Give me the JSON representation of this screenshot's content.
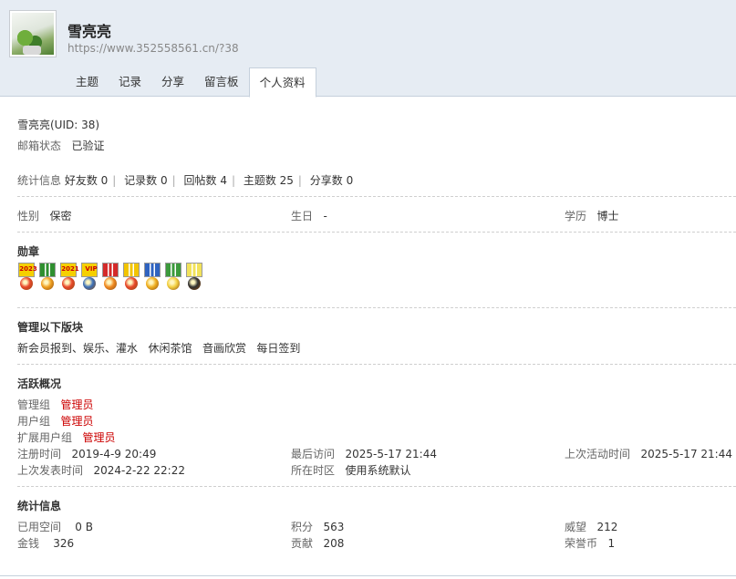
{
  "profile": {
    "name": "雪亮亮",
    "url": "https://www.352558561.cn/?38",
    "uid_line": "雪亮亮(UID: 38)",
    "email_label": "邮箱状态",
    "email_value": "已验证"
  },
  "tabs": [
    "主题",
    "记录",
    "分享",
    "留言板",
    "个人资料"
  ],
  "stats_line": {
    "label": "统计信息",
    "items": [
      "好友数 0",
      "记录数 0",
      "回帖数 4",
      "主题数 25",
      "分享数 0"
    ]
  },
  "basic": {
    "gender_label": "性别",
    "gender_value": "保密",
    "birthday_label": "生日",
    "birthday_value": "-",
    "education_label": "学历",
    "education_value": "博士"
  },
  "medals": {
    "title": "勋章",
    "items": [
      {
        "ribbon_text": "2023",
        "ribbon": "#f5d000",
        "coin": "#e8482a",
        "name": "medal-2023-icon"
      },
      {
        "ribbon_text": "",
        "ribbon": "#2f8f2f",
        "coin": "#f0a020",
        "name": "medal-green-red-icon"
      },
      {
        "ribbon_text": "2021",
        "ribbon": "#f5d000",
        "coin": "#e8482a",
        "name": "medal-2021-icon"
      },
      {
        "ribbon_text": "VIP",
        "ribbon": "#f5d000",
        "coin": "#3a6fb8",
        "name": "medal-vip-icon"
      },
      {
        "ribbon_text": "",
        "ribbon": "#d42a2a",
        "coin": "#f08a20",
        "name": "medal-red-white-icon"
      },
      {
        "ribbon_text": "",
        "ribbon": "#f2c400",
        "coin": "#e8482a",
        "name": "medal-yellow-red-icon"
      },
      {
        "ribbon_text": "",
        "ribbon": "#2f63c0",
        "coin": "#f0b020",
        "name": "medal-blue-icon"
      },
      {
        "ribbon_text": "",
        "ribbon": "#3c9a3c",
        "coin": "#f3d040",
        "name": "medal-star-icon"
      },
      {
        "ribbon_text": "",
        "ribbon": "#f2e25a",
        "coin": "#303030",
        "name": "medal-dark-coin-icon"
      }
    ]
  },
  "manage": {
    "title": "管理以下版块",
    "boards": [
      "新会员报到、娱乐、灌水",
      "休闲茶馆",
      "音画欣赏",
      "每日签到"
    ]
  },
  "activity": {
    "title": "活跃概况",
    "admin_group_label": "管理组",
    "admin_group_value": "管理员",
    "user_group_label": "用户组",
    "user_group_value": "管理员",
    "ext_group_label": "扩展用户组",
    "ext_group_value": "管理员",
    "register_label": "注册时间",
    "register_value": "2019-4-9 20:49",
    "last_visit_label": "最后访问",
    "last_visit_value": "2025-5-17 21:44",
    "last_active_label": "上次活动时间",
    "last_active_value": "2025-5-17 21:44",
    "last_post_label": "上次发表时间",
    "last_post_value": "2024-2-22 22:22",
    "timezone_label": "所在时区",
    "timezone_value": "使用系统默认"
  },
  "statistics": {
    "title": "统计信息",
    "space_label": "已用空间",
    "space_value": "0 B",
    "points_label": "积分",
    "points_value": "563",
    "prestige_label": "威望",
    "prestige_value": "212",
    "money_label": "金钱",
    "money_value": "326",
    "contribution_label": "贡献",
    "contribution_value": "208",
    "honor_label": "荣誉币",
    "honor_value": "1"
  }
}
